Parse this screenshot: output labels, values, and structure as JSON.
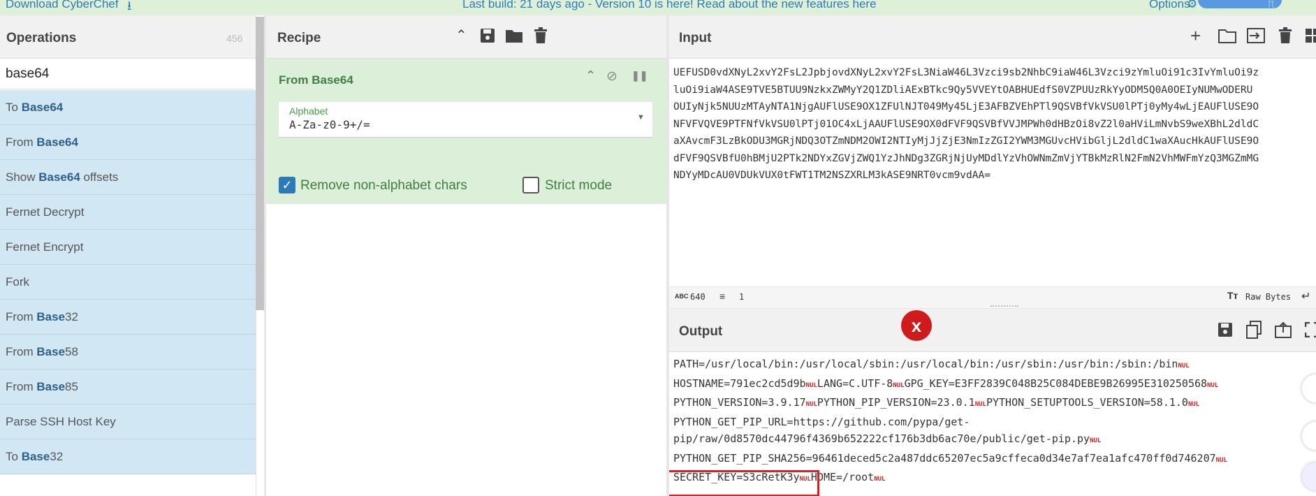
{
  "banner": {
    "download_label": "Download CyberChef",
    "message": "Last build: 21 days ago - Version 10 is here! Read about the new features here",
    "options_label": "Options",
    "trailing_text": "ft"
  },
  "operations": {
    "title": "Operations",
    "count": "456",
    "search_value": "base64",
    "items": [
      {
        "pre": "To ",
        "bold": "Base64",
        "post": ""
      },
      {
        "pre": "From ",
        "bold": "Base64",
        "post": ""
      },
      {
        "pre": "Show ",
        "bold": "Base64",
        "post": " offsets"
      },
      {
        "pre": "Fernet Decrypt",
        "bold": "",
        "post": ""
      },
      {
        "pre": "Fernet Encrypt",
        "bold": "",
        "post": ""
      },
      {
        "pre": "Fork",
        "bold": "",
        "post": ""
      },
      {
        "pre": "From ",
        "bold": "Base",
        "post": "32"
      },
      {
        "pre": "From ",
        "bold": "Base",
        "post": "58"
      },
      {
        "pre": "From ",
        "bold": "Base",
        "post": "85"
      },
      {
        "pre": "Parse SSH Host Key",
        "bold": "",
        "post": ""
      },
      {
        "pre": "To ",
        "bold": "Base",
        "post": "32"
      }
    ]
  },
  "recipe": {
    "title": "Recipe",
    "operation": {
      "title": "From Base64",
      "alphabet_label": "Alphabet",
      "alphabet_value": "A-Za-z0-9+/=",
      "remove_label": "Remove non-alphabet chars",
      "remove_checked": true,
      "strict_label": "Strict mode",
      "strict_checked": false
    }
  },
  "input": {
    "title": "Input",
    "lines": [
      "UEFUSD0vdXNyL2xvY2FsL2JpbjovdXNyL2xvY2FsL3NiaW46L3Vzci9sb2NhbC9iaW46L3Vzci9zYmluOi91c3IvYmluOi9z",
      "luOi9iaW4ASE9TVE5BTUU9NzkxZWMyY2Q1ZDliAExBTkc9Qy5VVEYtOABHUEdfS0VZPUUzRkYyODM5Q0A0OEIyNUMwODERU",
      "OUIyNjk5NUUzMTAyNTA1NjgAUFlUSE9OX1ZFUlNJT049My45LjE3AFBZVEhPTl9QSVBfVkVSU0lPTj0yMy4wLjEAUFlUSE9O",
      "NFVFVQVE9PTFNfVkVSU0lPTj01OC4xLjAAUFlUSE9OX0dFVF9QSVBfVVJMPWh0dHBzOi8vZ2l0aHViLmNvbS9weXBhL2dldC",
      "aXAvcmF3LzBkODU3MGRjNDQ3OTZmNDM2OWI2NTIyMjJjZjE3NmIzZGI2YWM3MGUvcHVibGljL2dldC1waXAucHkAUFlUSE9O",
      "dFVF9QSVBfU0hBMjU2PTk2NDYxZGVjZWQ1YzJhNDg3ZGRjNjUyMDdlYzVhOWNmZmVjYTBkMzRlN2FmN2VhMWFmYzQ3MGZmMG",
      "NDYyMDcAU0VDUkVUX0tFWT1TM2NSZXRLM3kASE9NRT0vcm9vdAA="
    ],
    "char_count": "640",
    "line_count": "1",
    "encoding_label": "Raw Bytes"
  },
  "output": {
    "title": "Output",
    "nul_glyph": "NUL",
    "lines": [
      {
        "segments": [
          "PATH=/usr/local/bin:/usr/local/sbin:/usr/local/bin:/usr/sbin:/usr/bin:/sbin:/bin",
          "NUL"
        ]
      },
      {
        "segments": [
          "HOSTNAME=791ec2cd5d9b",
          "NUL",
          "LANG=C.UTF-8",
          "NUL",
          "GPG_KEY=E3FF2839C048B25C084DEBE9B26995E310250568",
          "NUL"
        ]
      },
      {
        "segments": [
          "PYTHON_VERSION=3.9.17",
          "NUL",
          "PYTHON_PIP_VERSION=23.0.1",
          "NUL",
          "PYTHON_SETUPTOOLS_VERSION=58.1.0",
          "NUL"
        ]
      },
      {
        "segments": [
          "PYTHON_GET_PIP_URL=https://github.com/pypa/get-"
        ]
      },
      {
        "segments": [
          "pip/raw/0d8570dc44796f4369b652222cf176b3db6ac70e/public/get-pip.py",
          "NUL"
        ]
      },
      {
        "segments": [
          "PYTHON_GET_PIP_SHA256=96461deced5c2a487ddc65207ec5a9cffeca0d34e7af7ea1afc470ff0d746207",
          "NUL"
        ]
      },
      {
        "segments": [
          "SECRET_KEY=S3cRetK3y",
          "NUL",
          "HOME=/root",
          "NUL"
        ]
      }
    ]
  },
  "colors": {
    "banner_bg": "#dff0d8",
    "link": "#2b7bb9",
    "recipe_card": "#dcefd8",
    "op_item_bg": "#d1e7f3",
    "highlight_box": "#e02020",
    "error_badge": "#cf1b1b"
  }
}
